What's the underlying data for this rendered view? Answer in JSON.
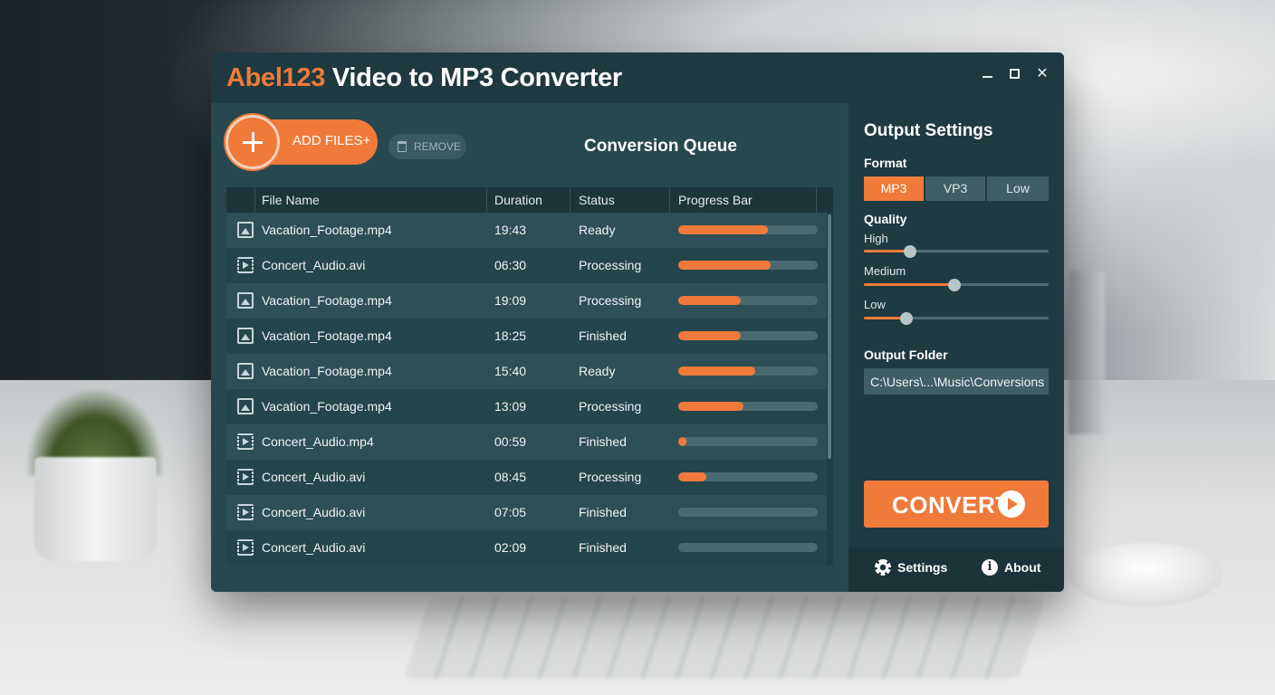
{
  "window": {
    "title_brand": "Abel123",
    "title_rest": " Video to MP3 Converter",
    "controls": {
      "minimize": "minimize",
      "maximize": "maximize",
      "close": "✕"
    }
  },
  "toolbar": {
    "add_files_label": "ADD FILES+",
    "remove_label": "REMOVE"
  },
  "queue": {
    "title": "Conversion Queue",
    "columns": [
      "File Name",
      "Duration",
      "Status",
      "Progress Bar"
    ],
    "rows": [
      {
        "icon": "image-file-icon",
        "name": "Vacation_Footage.mp4",
        "duration": "19:43",
        "status": "Ready",
        "progress": 0.64
      },
      {
        "icon": "video-file-icon",
        "name": "Concert_Audio.avi",
        "duration": "06:30",
        "status": "Processing",
        "progress": 0.66
      },
      {
        "icon": "image-file-icon",
        "name": "Vacation_Footage.mp4",
        "duration": "19:09",
        "status": "Processing",
        "progress": 0.45
      },
      {
        "icon": "image-file-icon",
        "name": "Vacation_Footage.mp4",
        "duration": "18:25",
        "status": "Finished",
        "progress": 0.45
      },
      {
        "icon": "image-file-icon",
        "name": "Vacation_Footage.mp4",
        "duration": "15:40",
        "status": "Ready",
        "progress": 0.55
      },
      {
        "icon": "image-file-icon",
        "name": "Vacation_Footage.mp4",
        "duration": "13:09",
        "status": "Processing",
        "progress": 0.47
      },
      {
        "icon": "video-file-icon",
        "name": "Concert_Audio.mp4",
        "duration": "00:59",
        "status": "Finished",
        "progress": 0.06
      },
      {
        "icon": "video-file-icon",
        "name": "Concert_Audio.avi",
        "duration": "08:45",
        "status": "Processing",
        "progress": 0.2
      },
      {
        "icon": "video-file-icon",
        "name": "Concert_Audio.avi",
        "duration": "07:05",
        "status": "Finished",
        "progress": 0
      },
      {
        "icon": "video-file-icon",
        "name": "Concert_Audio.avi",
        "duration": "02:09",
        "status": "Finished",
        "progress": 0
      }
    ]
  },
  "settings": {
    "title": "Output Settings",
    "format_label": "Format",
    "formats": [
      "MP3",
      "VP3",
      "Low"
    ],
    "selected_format": "MP3",
    "quality_label": "Quality",
    "quality_sliders": [
      {
        "label": "High",
        "value": 0.25
      },
      {
        "label": "Medium",
        "value": 0.49
      },
      {
        "label": "Low",
        "value": 0.23
      }
    ],
    "output_folder_label": "Output Folder",
    "output_folder_value": "C:\\Users\\...\\Music\\Conversions",
    "convert_label": "CONVERT"
  },
  "footer": {
    "settings_label": "Settings",
    "about_label": "About"
  },
  "colors": {
    "accent": "#ef7a3a",
    "window_bg": "#1f3b42",
    "panel_bg": "#27484f"
  }
}
